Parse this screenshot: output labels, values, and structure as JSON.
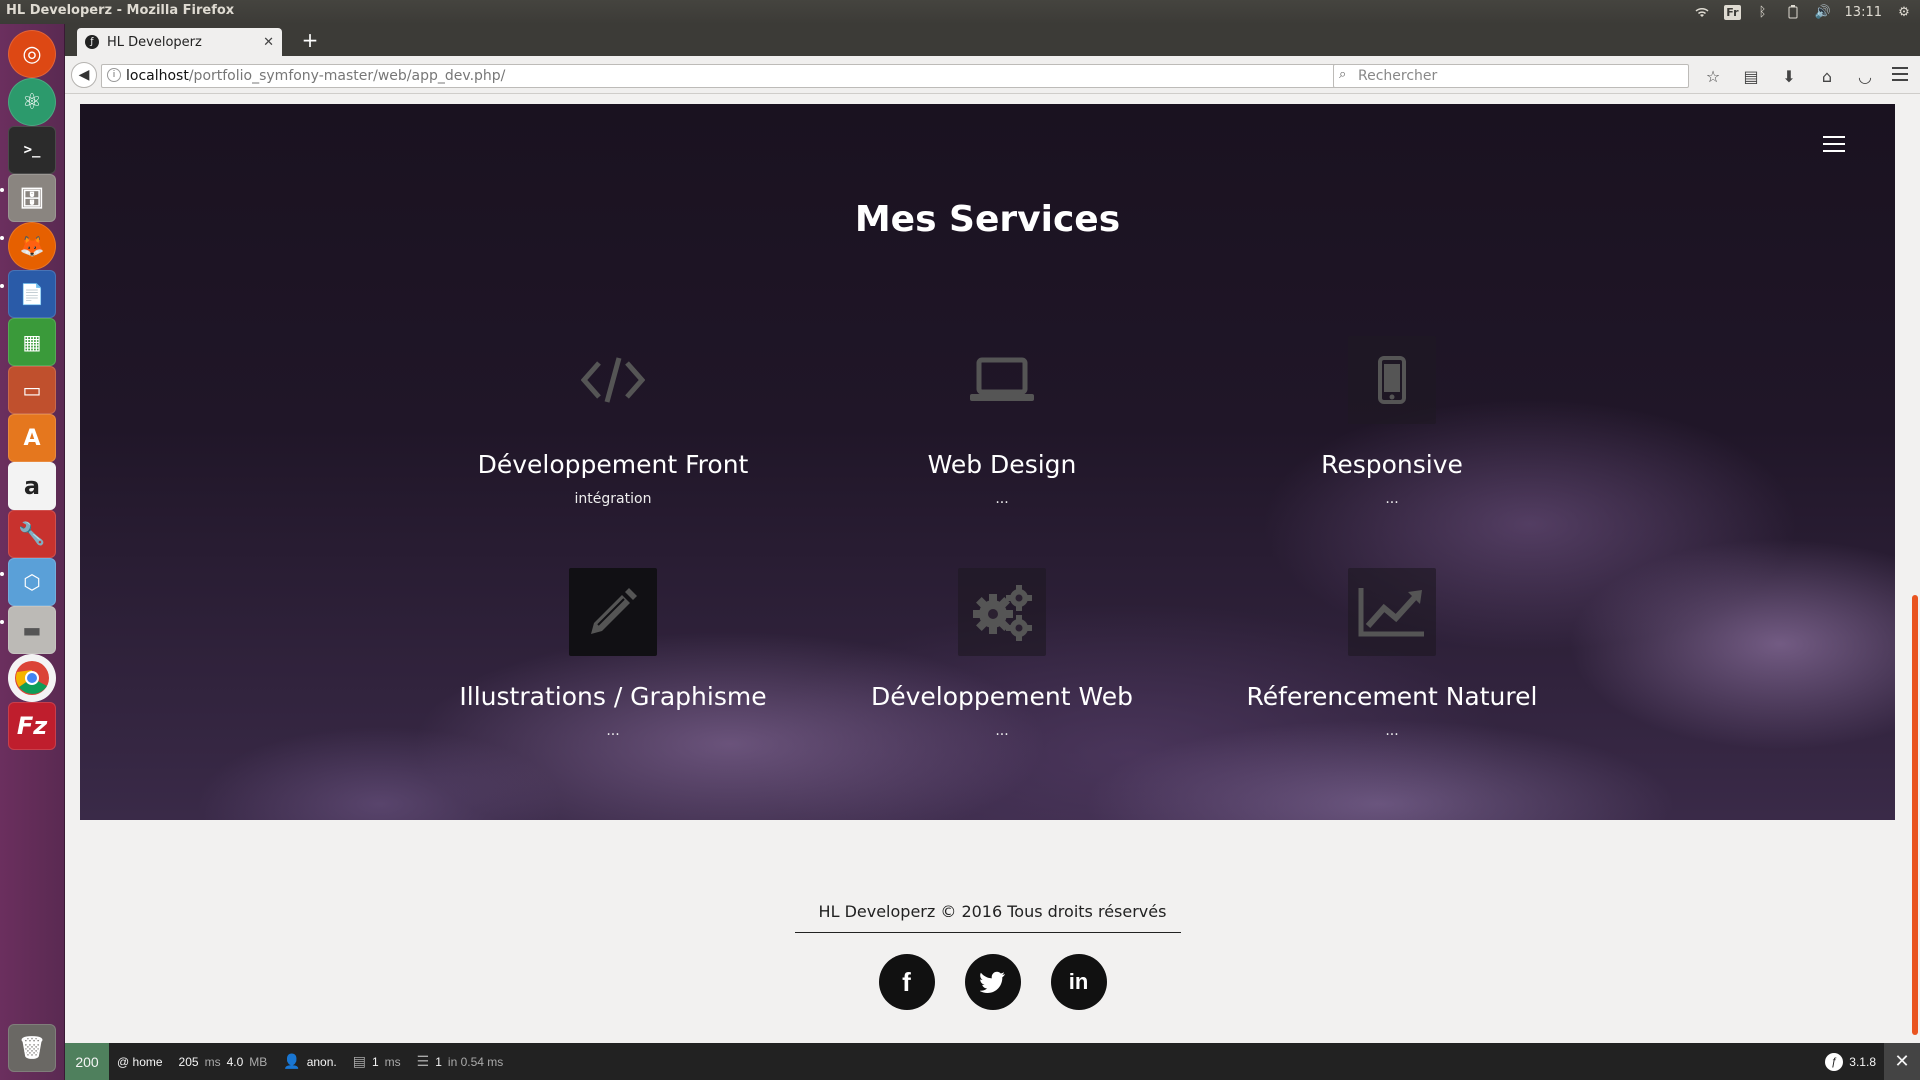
{
  "window": {
    "title": "HL Developerz - Mozilla Firefox"
  },
  "tray": {
    "keyboard": "Fr",
    "clock": "13:11"
  },
  "browser": {
    "tab_title": "HL Developerz",
    "url_host": "localhost",
    "url_path": "/portfolio_symfony-master/web/app_dev.php/",
    "search_placeholder": "Rechercher"
  },
  "services": {
    "title": "Mes Services",
    "items": [
      {
        "name": "Développement Front",
        "desc": "intégration",
        "icon": "code-icon"
      },
      {
        "name": "Web Design",
        "desc": "...",
        "icon": "laptop-icon"
      },
      {
        "name": "Responsive",
        "desc": "...",
        "icon": "mobile-icon"
      },
      {
        "name": "Illustrations / Graphisme",
        "desc": "...",
        "icon": "pencil-icon"
      },
      {
        "name": "Développement Web",
        "desc": "...",
        "icon": "gears-icon"
      },
      {
        "name": "Réferencement Naturel",
        "desc": "...",
        "icon": "line-chart-icon"
      }
    ]
  },
  "footer": {
    "copyright": "HL Developerz © 2016 Tous droits réservés",
    "socials": [
      "facebook",
      "twitter",
      "linkedin"
    ]
  },
  "symfony_toolbar": {
    "status_code": "200",
    "route": "@ home",
    "time": "205",
    "time_unit": "ms",
    "memory": "4.0",
    "memory_unit": "MB",
    "user": "anon.",
    "render": "1",
    "render_unit": "ms",
    "db": "1",
    "db_detail": "in 0.54 ms",
    "version": "3.1.8"
  },
  "colors": {
    "accent": "#e95420",
    "status_ok": "#4f805d",
    "launcher": "#5a2a52"
  }
}
